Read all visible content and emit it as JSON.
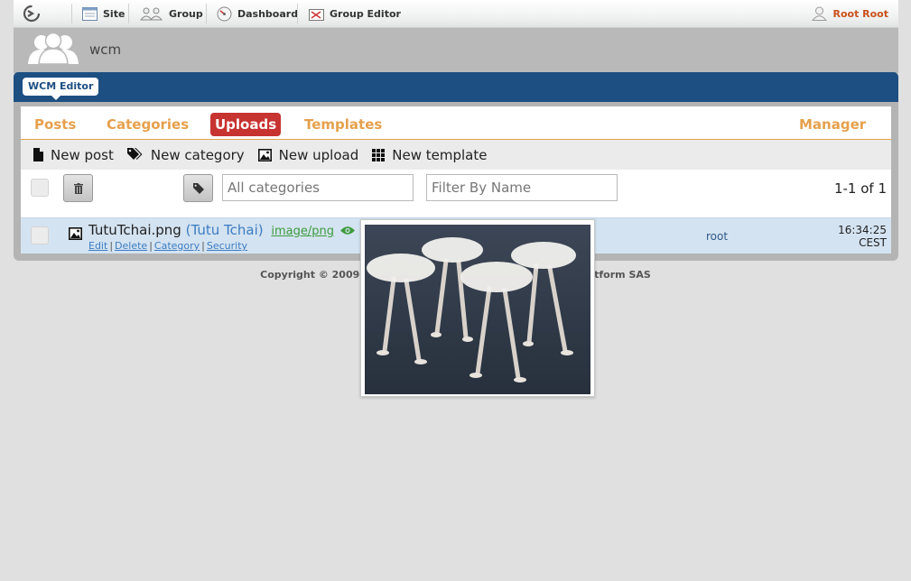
{
  "topbar": {
    "items": [
      {
        "label": "Site",
        "icon": "site-icon"
      },
      {
        "label": "Group",
        "icon": "group-icon"
      },
      {
        "label": "Dashboard",
        "icon": "dashboard-icon"
      },
      {
        "label": "Group Editor",
        "icon": "group-editor-icon"
      }
    ],
    "user": "Root Root"
  },
  "space": {
    "name": "wcm"
  },
  "portlet": {
    "tab": "WCM Editor"
  },
  "tabs": [
    {
      "label": "Posts",
      "active": false
    },
    {
      "label": "Categories",
      "active": false
    },
    {
      "label": "Uploads",
      "active": true
    },
    {
      "label": "Templates",
      "active": false
    },
    {
      "label": "Manager",
      "active": false
    }
  ],
  "actions": [
    {
      "label": "New post",
      "icon": "file-icon"
    },
    {
      "label": "New category",
      "icon": "tags-icon"
    },
    {
      "label": "New upload",
      "icon": "picture-icon"
    },
    {
      "label": "New template",
      "icon": "grid-icon"
    }
  ],
  "filters": {
    "category_placeholder": "All categories",
    "name_placeholder": "Filter By Name",
    "pager": "1-1 of 1"
  },
  "row": {
    "name": "TutuTchai.png",
    "title": "(Tutu Tchai)",
    "mime": "image/png",
    "links": [
      "Edit",
      "Delete",
      "Category",
      "Security"
    ],
    "author": "root",
    "time": "16:34:25",
    "timezone": "CEST"
  },
  "footer": {
    "copyright_start": "Copyright © 2009-20",
    "copyright_end": "tform SAS"
  },
  "colors": {
    "accent": "#e6a04c",
    "active_tab": "#c73330",
    "portlet_bar": "#1d4f82",
    "row_bg": "#d4e3f1"
  }
}
